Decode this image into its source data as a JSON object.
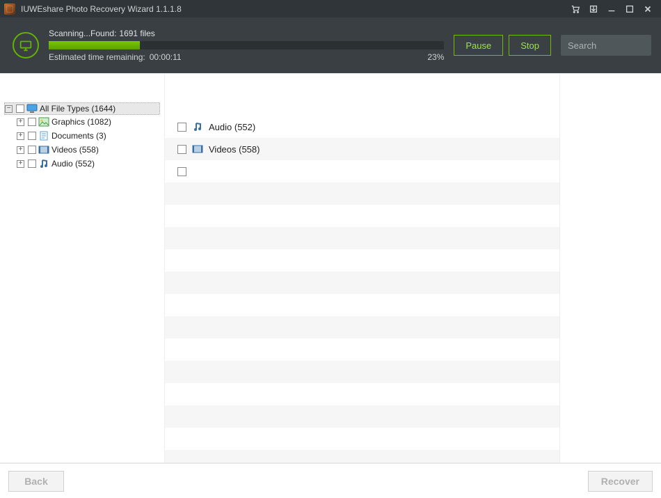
{
  "app": {
    "title": "IUWEshare Photo Recovery Wizard 1.1.1.8"
  },
  "status": {
    "prefix": "Scanning...Found:",
    "count": "1691 files",
    "time_label": "Estimated time remaining:",
    "time_value": "00:00:11",
    "percent": "23%",
    "percent_value": 23
  },
  "buttons": {
    "pause": "Pause",
    "stop": "Stop",
    "back": "Back",
    "recover": "Recover"
  },
  "search": {
    "placeholder": "Search"
  },
  "tree": {
    "root": {
      "label": "All File Types (1644)"
    },
    "children": [
      {
        "label": "Graphics (1082)",
        "icon": "image"
      },
      {
        "label": "Documents (3)",
        "icon": "doc"
      },
      {
        "label": "Videos (558)",
        "icon": "video"
      },
      {
        "label": "Audio (552)",
        "icon": "audio"
      }
    ]
  },
  "list": [
    {
      "label": "Audio (552)",
      "icon": "audio"
    },
    {
      "label": "Videos (558)",
      "icon": "video"
    }
  ],
  "colors": {
    "accent": "#6fbf00"
  }
}
